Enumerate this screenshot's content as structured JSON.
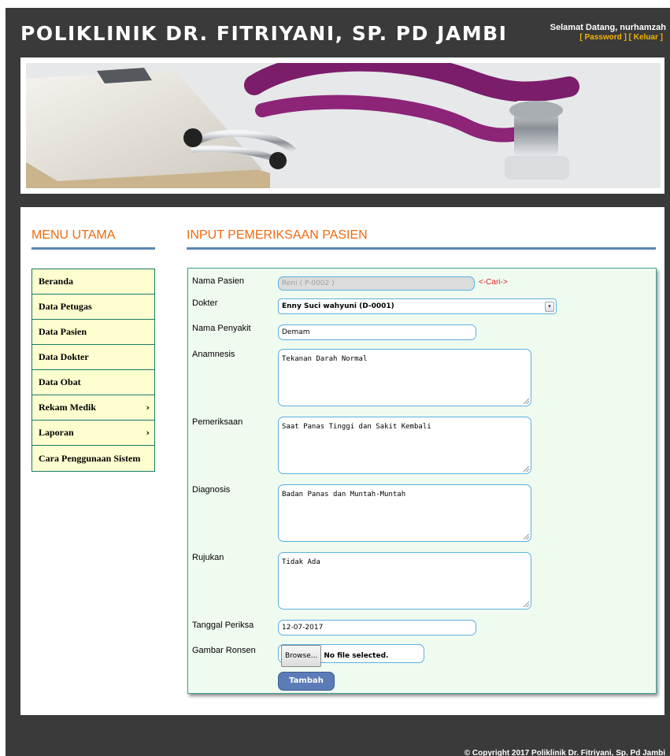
{
  "header": {
    "title": "POLIKLINIK DR. FITRIYANI, SP. PD JAMBI",
    "welcome": "Selamat Datang, nurhamzah",
    "link_password": "[ Password ]",
    "link_logout": "[ Keluar ]"
  },
  "sidebar": {
    "title": "MENU UTAMA",
    "items": [
      {
        "label": "Beranda"
      },
      {
        "label": "Data Petugas"
      },
      {
        "label": "Data Pasien"
      },
      {
        "label": "Data Dokter"
      },
      {
        "label": "Data Obat"
      },
      {
        "label": "Rekam Medik",
        "submenu_icon": "chevron-right-icon"
      },
      {
        "label": "Laporan",
        "submenu_icon": "chevron-right-icon"
      },
      {
        "label": "Cara Penggunaan Sistem"
      }
    ]
  },
  "form": {
    "title": "INPUT PEMERIKSAAN PASIEN",
    "nama_pasien": {
      "label": "Nama Pasien",
      "value": "Reni ( P-0002 )",
      "search_link": "<-Cari->"
    },
    "dokter": {
      "label": "Dokter",
      "value": "Enny Suci wahyuni (D-0001)"
    },
    "nama_penyakit": {
      "label": "Nama Penyakit",
      "value": "Demam"
    },
    "anamnesis": {
      "label": "Anamnesis",
      "value": "Tekanan Darah Normal"
    },
    "pemeriksaan": {
      "label": "Pemeriksaan",
      "value": "Saat Panas Tinggi dan Sakit Kembali"
    },
    "diagnosis": {
      "label": "Diagnosis",
      "value": "Badan Panas dan Muntah-Muntah"
    },
    "rujukan": {
      "label": "Rujukan",
      "value": "Tidak Ada"
    },
    "tanggal_periksa": {
      "label": "Tanggal Periksa",
      "value": "12-07-2017"
    },
    "gambar_ronsen": {
      "label": "Gambar Ronsen",
      "button": "Browse...",
      "status": "No file selected."
    },
    "submit_label": "Tambah"
  },
  "footer": {
    "copyright": "© Copyright 2017 Poliklinik Dr. Fitriyani, Sp. Pd Jambi"
  },
  "colors": {
    "accent_orange": "#f06a10",
    "menu_bg": "#fefecf",
    "panel_bg": "#f0fbf0",
    "button_blue": "#5b7cb6",
    "link_yellow": "#f5b400"
  }
}
